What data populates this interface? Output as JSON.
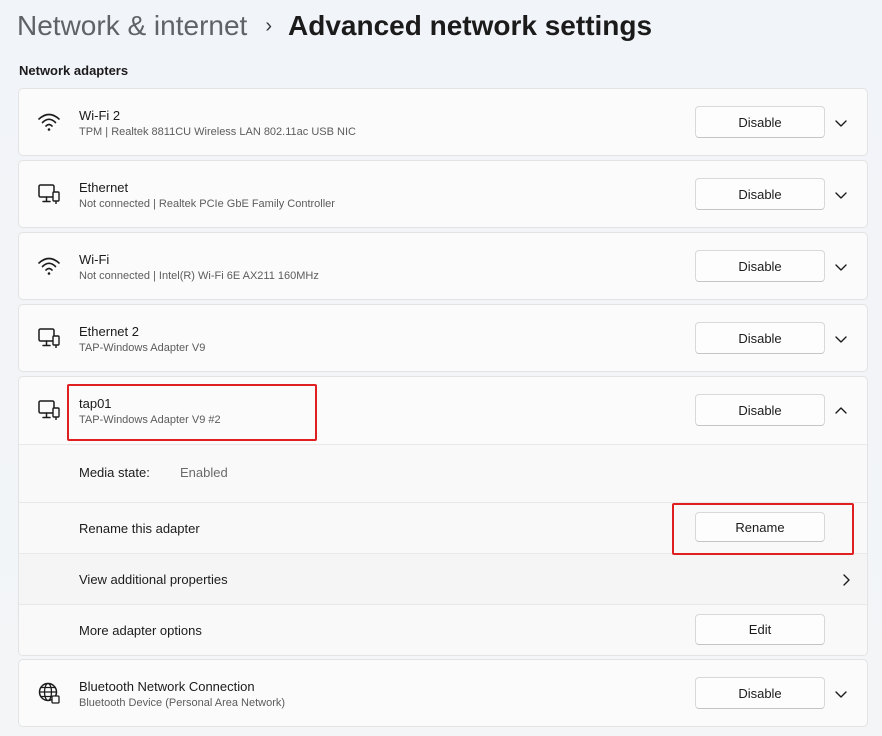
{
  "breadcrumb": {
    "parent": "Network & internet",
    "separator": "›",
    "current": "Advanced network settings"
  },
  "section_title": "Network adapters",
  "adapters": [
    {
      "name": "Wi-Fi 2",
      "description": "TPM | Realtek 8811CU Wireless LAN 802.11ac USB NIC",
      "icon": "wifi-icon",
      "button": "Disable"
    },
    {
      "name": "Ethernet",
      "description": "Not connected | Realtek PCIe GbE Family Controller",
      "icon": "ethernet-icon",
      "button": "Disable"
    },
    {
      "name": "Wi-Fi",
      "description": "Not connected | Intel(R) Wi-Fi 6E AX211 160MHz",
      "icon": "wifi-icon",
      "button": "Disable"
    },
    {
      "name": "Ethernet 2",
      "description": "TAP-Windows Adapter V9",
      "icon": "ethernet-icon",
      "button": "Disable"
    },
    {
      "name": "tap01",
      "description": "TAP-Windows Adapter V9 #2",
      "icon": "ethernet-icon",
      "button": "Disable"
    },
    {
      "name": "Bluetooth Network Connection",
      "description": "Bluetooth Device (Personal Area Network)",
      "icon": "globe-icon",
      "button": "Disable"
    }
  ],
  "expanded": {
    "media_state_label": "Media state:",
    "media_state_value": "Enabled",
    "rename_label": "Rename this adapter",
    "rename_button": "Rename",
    "properties_label": "View additional properties",
    "more_options_label": "More adapter options",
    "edit_button": "Edit"
  },
  "colors": {
    "highlight": "#e02020"
  }
}
